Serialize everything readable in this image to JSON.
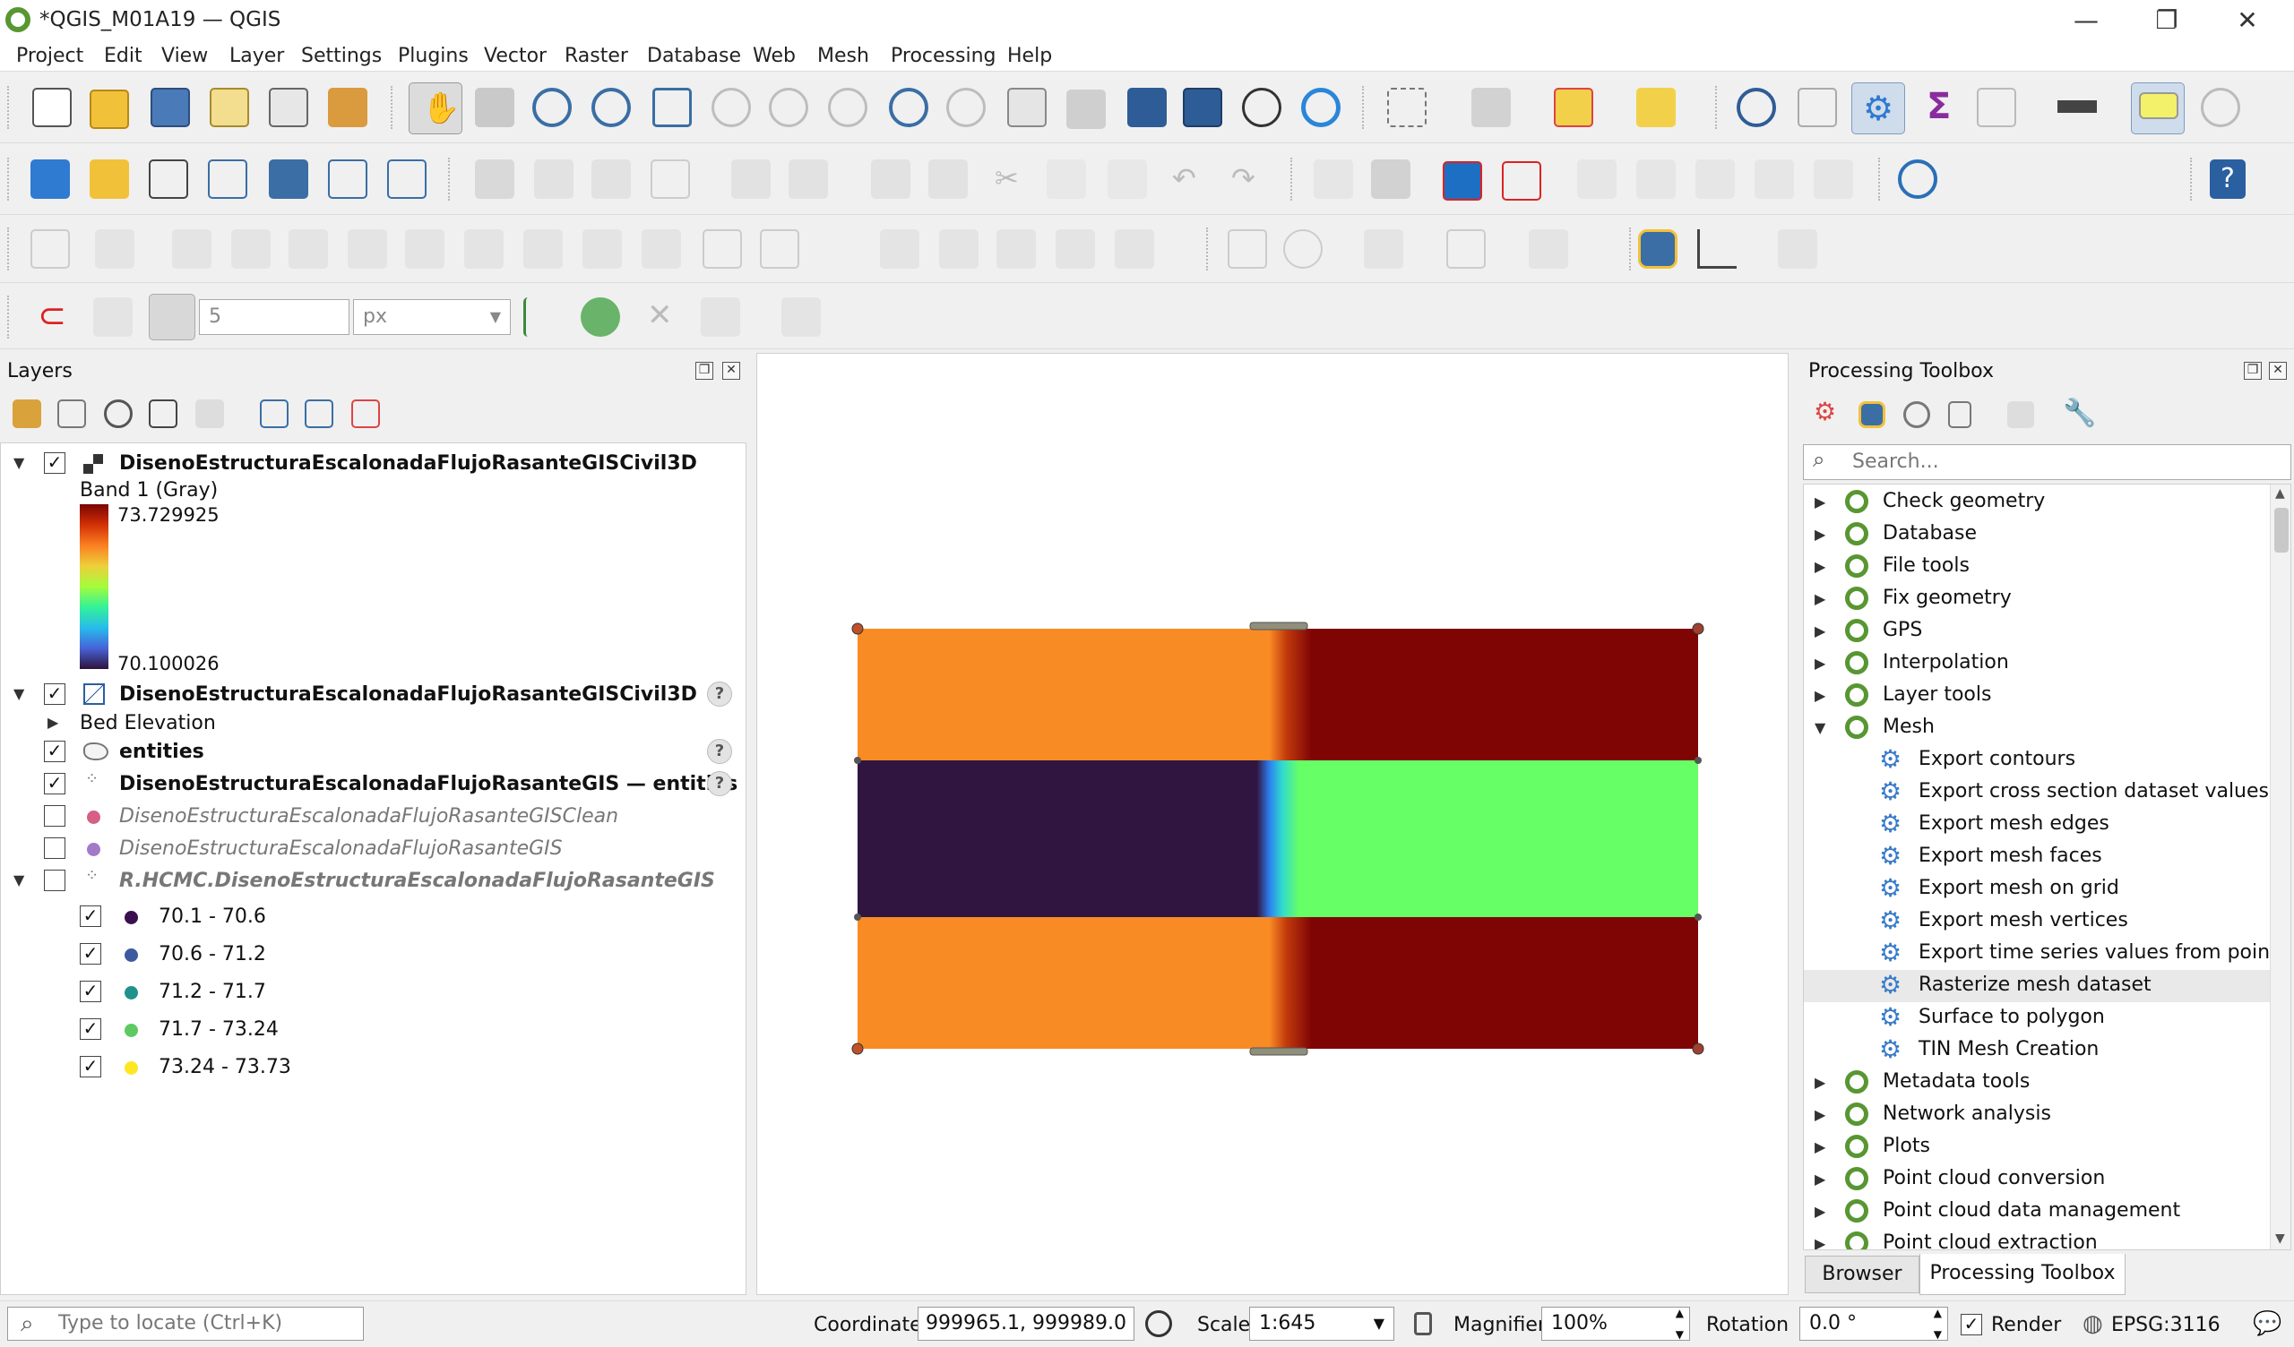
{
  "window": {
    "title": "*QGIS_M01A19 — QGIS",
    "minimize": "—",
    "restore": "❐",
    "close": "✕"
  },
  "menu": [
    "Project",
    "Edit",
    "View",
    "Layer",
    "Settings",
    "Plugins",
    "Vector",
    "Raster",
    "Database",
    "Web",
    "Mesh",
    "Processing",
    "Help"
  ],
  "snapping": {
    "tolerance": "5",
    "unit": "px"
  },
  "layers_panel": {
    "title": "Layers",
    "raster_layer": {
      "name": "DisenoEstructuraEscalonadaFlujoRasanteGISCivil3D",
      "band": "Band 1 (Gray)",
      "max": "73.729925",
      "min": "70.100026"
    },
    "mesh_layer": {
      "name": "DisenoEstructuraEscalonadaFlujoRasanteGISCivil3D",
      "child": "Bed Elevation"
    },
    "entities": "entities",
    "gis_entities": "DisenoEstructuraEscalonadaFlujoRasanteGIS — entities",
    "clean": "DisenoEstructuraEscalonadaFlujoRasanteGISClean",
    "gis": "DisenoEstructuraEscalonadaFlujoRasanteGIS",
    "rhcmc": "R.HCMC.DisenoEstructuraEscalonadaFlujoRasanteGIS",
    "classes": [
      {
        "label": "70.1 - 70.6",
        "color": "#3b0f4f"
      },
      {
        "label": "70.6 - 71.2",
        "color": "#3d5aa0"
      },
      {
        "label": "71.2 - 71.7",
        "color": "#21918c"
      },
      {
        "label": "71.7 - 73.24",
        "color": "#5ec962"
      },
      {
        "label": "73.24 - 73.73",
        "color": "#fde725"
      }
    ],
    "help": "?"
  },
  "map": {
    "colors": {
      "orange": "#f98b25",
      "darkred": "#7f0505",
      "purple": "#301540",
      "green": "#66ff66"
    }
  },
  "toolbox": {
    "title": "Processing Toolbox",
    "search_placeholder": "Search...",
    "groups_top": [
      "Check geometry",
      "Database",
      "File tools",
      "Fix geometry",
      "GPS",
      "Interpolation",
      "Layer tools"
    ],
    "mesh_group": "Mesh",
    "mesh_items": [
      "Export contours",
      "Export cross section dataset values o...",
      "Export mesh edges",
      "Export mesh faces",
      "Export mesh on grid",
      "Export mesh vertices",
      "Export time series values from points...",
      "Rasterize mesh dataset",
      "Surface to polygon",
      "TIN Mesh Creation"
    ],
    "groups_bottom": [
      "Metadata tools",
      "Network analysis",
      "Plots",
      "Point cloud conversion",
      "Point cloud data management",
      "Point cloud extraction"
    ],
    "tabs": [
      "Browser",
      "Processing Toolbox"
    ]
  },
  "status": {
    "locate_placeholder": "Type to locate (Ctrl+K)",
    "coordinate_label": "Coordinate",
    "coordinate": "999965.1, 999989.0",
    "scale_label": "Scale",
    "scale": "1:645",
    "magnifier_label": "Magnifier",
    "magnifier": "100%",
    "rotation_label": "Rotation",
    "rotation": "0.0 °",
    "render": "Render",
    "crs": "EPSG:3116"
  }
}
